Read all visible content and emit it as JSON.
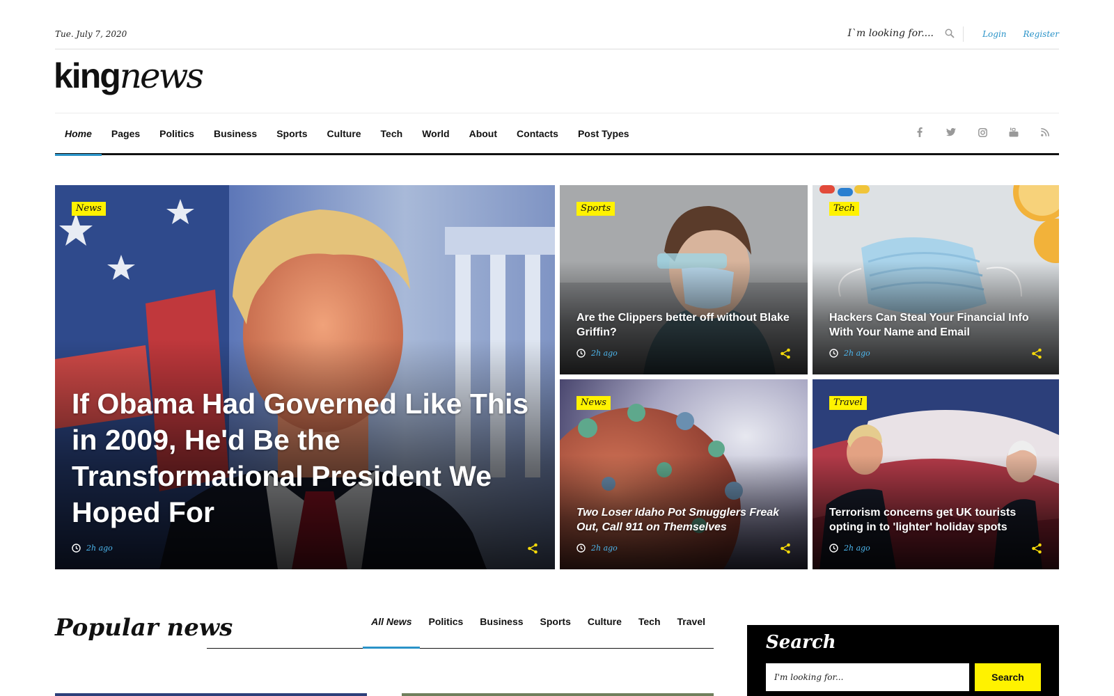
{
  "topbar": {
    "date": "Tue. July 7, 2020",
    "search_placeholder": "I`m looking for....",
    "login": "Login",
    "register": "Register"
  },
  "logo": {
    "part1": "king",
    "part2": "news"
  },
  "nav": {
    "items": [
      "Home",
      "Pages",
      "Politics",
      "Business",
      "Sports",
      "Culture",
      "Tech",
      "World",
      "About",
      "Contacts",
      "Post Types"
    ],
    "active": "Home",
    "social_icons": [
      "facebook-icon",
      "twitter-icon",
      "instagram-icon",
      "youtube-icon",
      "rss-icon"
    ]
  },
  "hero": {
    "main": {
      "category": "News",
      "title": "If Obama Had Governed Like This in 2009, He'd Be the Transformational President We Hoped For",
      "time": "2h ago"
    },
    "cards": [
      {
        "category": "Sports",
        "title": "Are the Clippers better off without Blake Griffin?",
        "time": "2h ago"
      },
      {
        "category": "Tech",
        "title": "Hackers Can Steal Your Financial Info With Your Name and Email",
        "time": "2h ago"
      },
      {
        "category": "News",
        "title": "Two Loser Idaho Pot Smugglers Freak Out, Call 911 on Themselves",
        "time": "2h ago"
      },
      {
        "category": "Travel",
        "title": "Terrorism concerns get UK tourists opting in to 'lighter' holiday spots",
        "time": "2h ago"
      }
    ]
  },
  "popular": {
    "title": "Popular news",
    "tabs": [
      "All News",
      "Politics",
      "Business",
      "Sports",
      "Culture",
      "Tech",
      "Travel"
    ],
    "active": "All News"
  },
  "search_widget": {
    "title": "Search",
    "placeholder": "I'm looking for...",
    "button": "Search"
  },
  "colors": {
    "accent_blue": "#2a93c8",
    "time_blue": "#4db7ee",
    "badge_yellow": "#fff200",
    "share_yellow": "#f5d90a"
  }
}
